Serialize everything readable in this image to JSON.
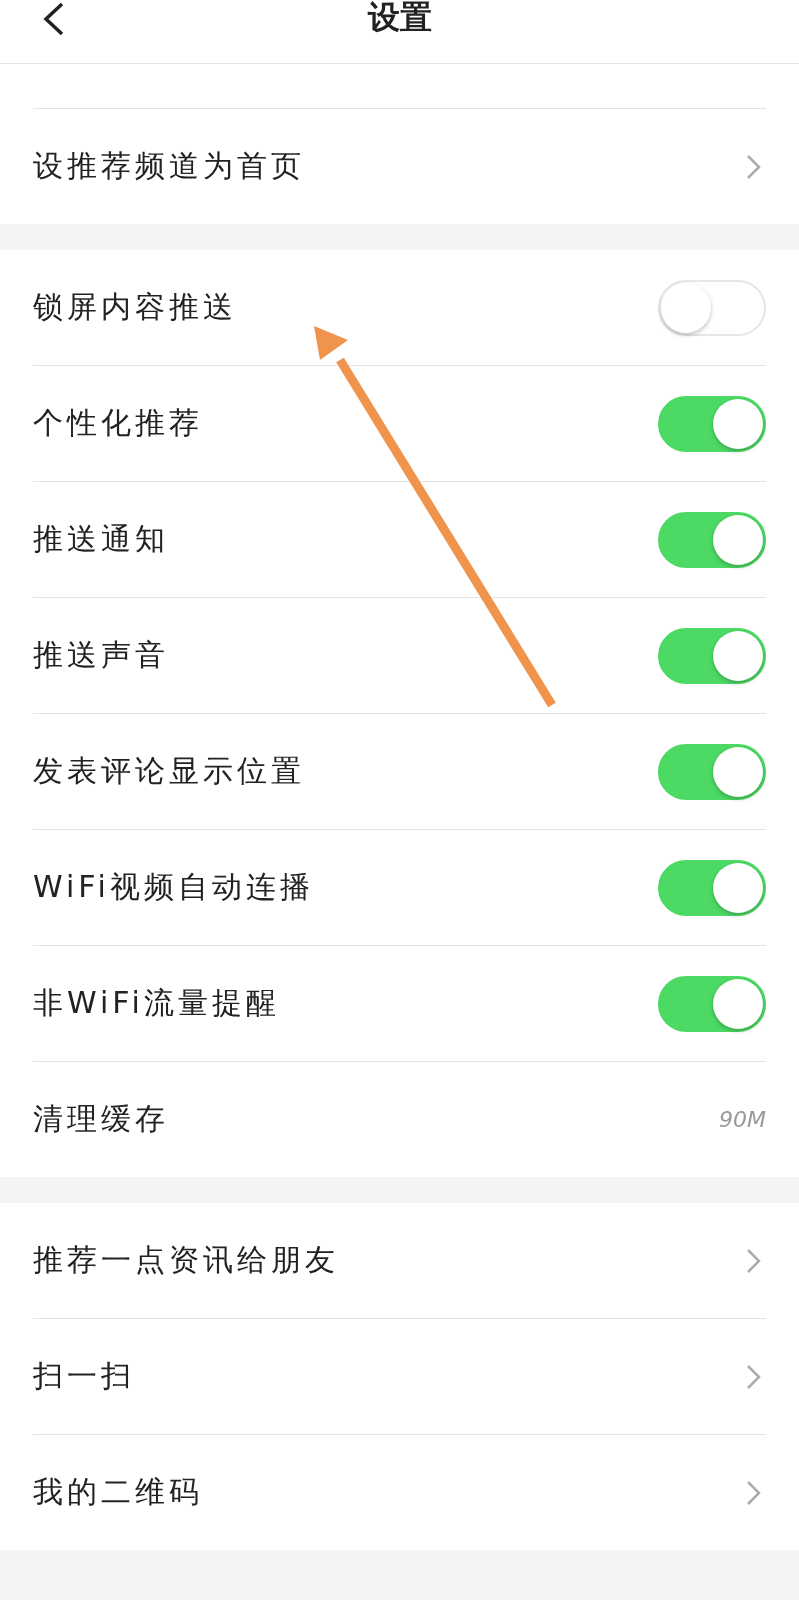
{
  "header": {
    "title": "设置"
  },
  "sections": [
    {
      "items": [
        {
          "kind": "link",
          "label": "设推荐频道为首页"
        }
      ]
    },
    {
      "items": [
        {
          "kind": "toggle",
          "label": "锁屏内容推送",
          "on": false
        },
        {
          "kind": "toggle",
          "label": "个性化推荐",
          "on": true
        },
        {
          "kind": "toggle",
          "label": "推送通知",
          "on": true
        },
        {
          "kind": "toggle",
          "label": "推送声音",
          "on": true
        },
        {
          "kind": "toggle",
          "label": "发表评论显示位置",
          "on": true
        },
        {
          "kind": "toggle",
          "label": "WiFi视频自动连播",
          "on": true
        },
        {
          "kind": "toggle",
          "label": "非WiFi流量提醒",
          "on": true
        },
        {
          "kind": "value",
          "label": "清理缓存",
          "value": "90M"
        }
      ]
    },
    {
      "items": [
        {
          "kind": "link",
          "label": "推荐一点资讯给朋友"
        },
        {
          "kind": "link",
          "label": "扫一扫"
        },
        {
          "kind": "link",
          "label": "我的二维码"
        }
      ]
    }
  ]
}
